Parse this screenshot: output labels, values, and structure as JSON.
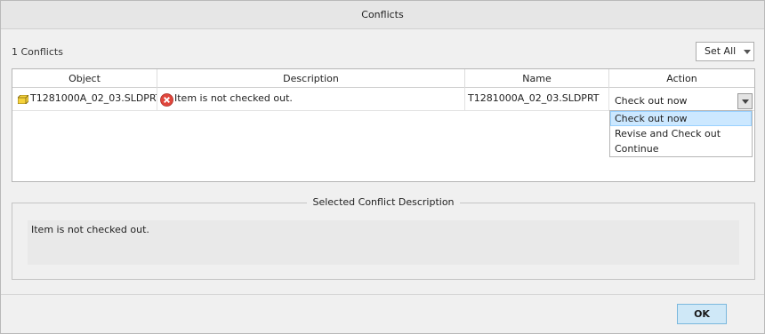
{
  "window": {
    "title": "Conflicts"
  },
  "summary": {
    "count_label": "1 Conflicts"
  },
  "set_all": {
    "label": "Set All"
  },
  "table": {
    "columns": [
      "Object",
      "Description",
      "Name",
      "Action"
    ],
    "rows": [
      {
        "object": "T1281000A_02_03.SLDPRT",
        "object_icon": "part-icon",
        "description": "Item is not checked out.",
        "description_icon": "error-icon",
        "name": "T1281000A_02_03.SLDPRT",
        "action": "Check out now"
      }
    ]
  },
  "action_dropdown": {
    "options": [
      "Check out now",
      "Revise and Check out",
      "Continue"
    ],
    "selected_index": 0
  },
  "selected_description": {
    "title": "Selected Conflict Description",
    "text": "Item is not checked out."
  },
  "footer": {
    "ok_label": "OK"
  },
  "colors": {
    "selection_highlight": "#cce8ff",
    "ok_button": "#cfe8f7",
    "error_red": "#e0463c",
    "part_yellow": "#f5d23a"
  }
}
